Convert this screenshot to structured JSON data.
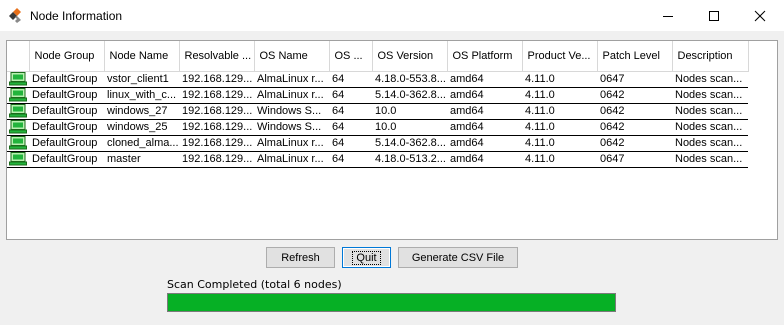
{
  "window": {
    "title": "Node Information",
    "icon": "app-logo-icon",
    "controls": [
      "minimize-icon",
      "maximize-icon",
      "close-icon"
    ]
  },
  "table": {
    "columns": [
      "",
      "Node Group",
      "Node Name",
      "Resolvable ...",
      "OS Name",
      "OS ...",
      "OS Version",
      "OS Platform",
      "Product Ve...",
      "Patch Level",
      "Description"
    ],
    "rows": [
      [
        "DefaultGroup",
        "vstor_client1",
        "192.168.129...",
        "AlmaLinux r...",
        "64",
        "4.18.0-553.8...",
        "amd64",
        "4.11.0",
        "0647",
        "Nodes scan..."
      ],
      [
        "DefaultGroup",
        "linux_with_c...",
        "192.168.129...",
        "AlmaLinux r...",
        "64",
        "5.14.0-362.8...",
        "amd64",
        "4.11.0",
        "0642",
        "Nodes scan..."
      ],
      [
        "DefaultGroup",
        "windows_27",
        "192.168.129...",
        "Windows S...",
        "64",
        "10.0",
        "amd64",
        "4.11.0",
        "0642",
        "Nodes scan..."
      ],
      [
        "DefaultGroup",
        "windows_25",
        "192.168.129...",
        "Windows S...",
        "64",
        "10.0",
        "amd64",
        "4.11.0",
        "0642",
        "Nodes scan..."
      ],
      [
        "DefaultGroup",
        "cloned_alma...",
        "192.168.129...",
        "AlmaLinux r...",
        "64",
        "5.14.0-362.8...",
        "amd64",
        "4.11.0",
        "0642",
        "Nodes scan..."
      ],
      [
        "DefaultGroup",
        "master",
        "192.168.129...",
        "AlmaLinux r...",
        "64",
        "4.18.0-513.2...",
        "amd64",
        "4.11.0",
        "0647",
        "Nodes scan..."
      ]
    ],
    "row_icon": "computer-node-icon"
  },
  "buttons": {
    "refresh": "Refresh",
    "quit": "Quit",
    "generate_csv": "Generate CSV File"
  },
  "status": {
    "text": "Scan Completed (total 6 nodes)",
    "progress": 1.0
  },
  "colors": {
    "progress": "#06b025",
    "focus": "#0078d7",
    "icon_green": "#22b43c"
  }
}
